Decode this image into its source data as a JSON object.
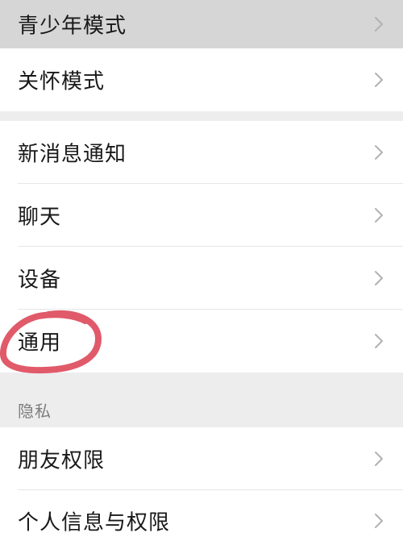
{
  "settings_list": {
    "group_1": [
      {
        "label": "青少年模式",
        "state": "pressed"
      },
      {
        "label": "关怀模式"
      }
    ],
    "group_2": [
      {
        "label": "新消息通知"
      },
      {
        "label": "聊天"
      },
      {
        "label": "设备"
      },
      {
        "label": "通用",
        "highlighted": true
      }
    ],
    "privacy_section": {
      "header": "隐私",
      "items": [
        {
          "label": "朋友权限"
        },
        {
          "label": "个人信息与权限"
        }
      ]
    }
  },
  "icons": {
    "chevron": "chevron-right-icon"
  },
  "colors": {
    "background": "#ededed",
    "row": "#ffffff",
    "pressed_row": "#d6d6d6",
    "text": "#191919",
    "secondary_text": "#7d7d7d",
    "chevron": "#b2b2b2",
    "annotation": "#e05a6a"
  }
}
